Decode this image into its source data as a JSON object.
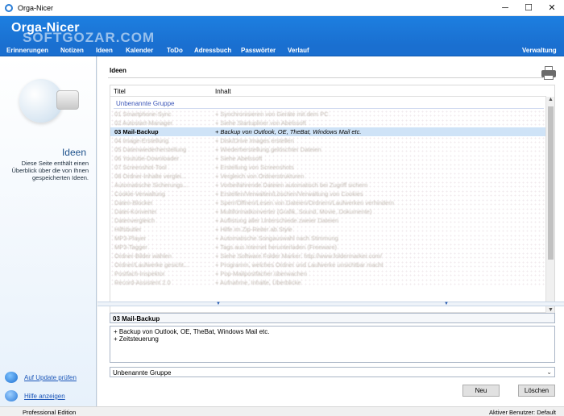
{
  "window": {
    "title": "Orga-Nicer",
    "minimize": "─",
    "maximize": "☐",
    "close": "✕"
  },
  "header": {
    "app_title": "Orga-Nicer",
    "watermark": "SOFTGOZAR.COM"
  },
  "nav": {
    "items": [
      "Erinnerungen",
      "Notizen",
      "Ideen",
      "Kalender",
      "ToDo",
      "Adressbuch",
      "Passwörter",
      "Verlauf"
    ],
    "right": "Verwaltung"
  },
  "sidebar": {
    "title": "Ideen",
    "description": "Diese Seite enthält einen Überblick über die von Ihnen gespeicherten Ideen.",
    "link_update": "Auf Update prüfen",
    "link_help": "Hilfe anzeigen"
  },
  "main": {
    "title": "Ideen",
    "columns": [
      "Titel",
      "Inhalt"
    ],
    "group": "Unbenannte Gruppe",
    "rows": [
      {
        "title": "01 Smartphone-Sync",
        "content": "+ Synchronisieren von Geräte mit dem PC"
      },
      {
        "title": "02 Autostart-Manager",
        "content": "+ Siehe Startupliner von Abelssoft"
      },
      {
        "title": "03 Mail-Backup",
        "content": "+ Backup von Outlook, OE, TheBat, Windows Mail etc."
      },
      {
        "title": "04 Image-Erstellung",
        "content": "+ Disk/Drive Images erstellen"
      },
      {
        "title": "05 Datenwiederherstellung",
        "content": "+ Wiederherstellung gelöschter Dateien"
      },
      {
        "title": "06 Youtube-Downloader",
        "content": "+ Siehe Abelssoft"
      },
      {
        "title": "07 Screenshot-Tool",
        "content": "+ Erstellung von Screenshots"
      },
      {
        "title": "08 Ordner-Inhalte verglei...",
        "content": "+ Vergleich von Ordnerstrukturen"
      },
      {
        "title": "Automatische Sicherungs...",
        "content": "+ Vorbeifahrende Dateien automatisch bei Zugriff sichern"
      },
      {
        "title": "Cookie-Verwaltung",
        "content": "+ Erstellen/Verwalten/Löschen/Verwaltung von Cookies"
      },
      {
        "title": "Daten-Blocker",
        "content": "+ Sperr/Öffnen/Lesen von Dateien/Ordnern/Laufwerken verhindern"
      },
      {
        "title": "Datei-Konverter",
        "content": "+ Multiformatkonverter (Grafik, Sound, Movie, Dokumente)"
      },
      {
        "title": "Datenvergleich",
        "content": "+ Auflistung aller Unterschiede zweier Dateien"
      },
      {
        "title": "Hilfsbutler",
        "content": "+ Hilfe im Zip-Reiter ab Style"
      },
      {
        "title": "MP3-Player",
        "content": "+ Automatische Songauswahl nach Stimmung"
      },
      {
        "title": "MP3-Tagger",
        "content": "+ Tags aus Internet herunterladen (Freeware)"
      },
      {
        "title": "Ordner-Bilder wählen",
        "content": "+ Siehe Software Folder Marker: http://www.foldermarker.com/"
      },
      {
        "title": "Ordner/Laufwerke gesicht...",
        "content": "+ Programm, welches Ordner und Laufwerke unsichtbar macht"
      },
      {
        "title": "Postfach-Inspektor",
        "content": "+ Pop-Mailpostfächer überwachen"
      },
      {
        "title": "Record-Assistent 2.0",
        "content": "+ Aufnahme, Inhalte, Überblicke"
      }
    ],
    "selected_index": 2
  },
  "detail": {
    "title": "03 Mail-Backup",
    "lines": [
      "+ Backup von Outlook, OE, TheBat, Windows Mail etc.",
      "+ Zeitsteuerung"
    ],
    "group": "Unbenannte Gruppe",
    "btn_new": "Neu",
    "btn_delete": "Löschen"
  },
  "status": {
    "left": "Professional Edition",
    "right": "Aktiver Benutzer: Default"
  },
  "colors": {
    "header_blue": "#1d7fe0",
    "link_blue": "#1a55b8",
    "selection": "#cfe3f7"
  }
}
